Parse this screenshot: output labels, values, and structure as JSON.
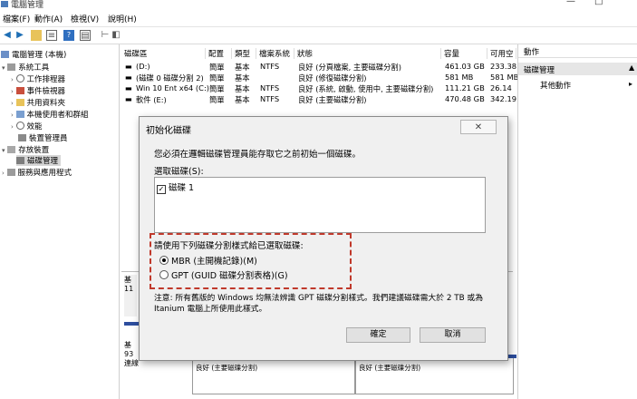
{
  "window": {
    "title": "電腦管理",
    "minimize_glyph": "—",
    "maximize_glyph": "□"
  },
  "menu": [
    "檔案(F)",
    "動作(A)",
    "檢視(V)",
    "說明(H)"
  ],
  "toolbar_icons": [
    "back-icon",
    "forward-icon",
    "folder-icon",
    "list-icon",
    "help-icon",
    "properties-icon",
    "pin-icon",
    "refresh-icon"
  ],
  "tree": [
    {
      "label": "電腦管理 (本機)",
      "icon": "computer-icon",
      "level": 0
    },
    {
      "label": "系統工具",
      "icon": "tools-icon",
      "level": 1
    },
    {
      "label": "工作排程器",
      "icon": "clock-icon",
      "level": 2
    },
    {
      "label": "事件檢視器",
      "icon": "log-icon",
      "level": 2
    },
    {
      "label": "共用資料夾",
      "icon": "folder-icon",
      "level": 2
    },
    {
      "label": "本機使用者和群組",
      "icon": "users-icon",
      "level": 2
    },
    {
      "label": "效能",
      "icon": "performance-icon",
      "level": 2
    },
    {
      "label": "裝置管理員",
      "icon": "device-icon",
      "level": 2
    },
    {
      "label": "存放裝置",
      "icon": "storage-icon",
      "level": 1
    },
    {
      "label": "磁碟管理",
      "icon": "disk-icon",
      "level": 2
    },
    {
      "label": "服務與應用程式",
      "icon": "services-icon",
      "level": 1
    }
  ],
  "volumes": {
    "headers": [
      "磁碟區",
      "配置",
      "類型",
      "檔案系統",
      "狀態",
      "容量",
      "可用空"
    ],
    "rows": [
      [
        "(D:)",
        "簡單",
        "基本",
        "NTFS",
        "良好 (分頁檔案, 主要磁碟分割)",
        "461.03 GB",
        "233.38"
      ],
      [
        "(磁碟 0 磁碟分割 2)",
        "簡單",
        "基本",
        "",
        "良好 (修復磁碟分割)",
        "581 MB",
        "581 MB"
      ],
      [
        "Win 10 Ent x64 (C:)",
        "簡單",
        "基本",
        "NTFS",
        "良好 (系統, 啟動, 使用中, 主要磁碟分割)",
        "111.21 GB",
        "26.14"
      ],
      [
        "軟件 (E:)",
        "簡單",
        "基本",
        "NTFS",
        "良好 (主要磁碟分割)",
        "470.48 GB",
        "342.19"
      ]
    ],
    "disk_labels": [
      "基",
      "11",
      "基",
      "93",
      "連線"
    ],
    "partition_status": [
      "良好 (主要磁碟分割)",
      "良好 (主要磁碟分割)",
      "良好 (分頁檔案, 主要磁碟分割)"
    ]
  },
  "actions": {
    "header": "動作",
    "section": "磁碟管理",
    "more": "其他動作"
  },
  "dialog": {
    "title": "初始化磁碟",
    "message": "您必須在邏輯磁碟管理員能存取它之前初始一個磁碟。",
    "select_label": "選取磁碟(S):",
    "disk_item": "磁碟 1",
    "style_label": "請使用下列磁碟分割樣式給已選取磁碟:",
    "option_mbr": "MBR (主開機記錄)(M)",
    "option_gpt": "GPT (GUID 磁碟分割表格)(G)",
    "selected_option": "MBR",
    "note": "注意: 所有舊版的 Windows 均無法辨識 GPT 磁碟分割樣式。我們建議磁碟需大於 2 TB 或為 Itanium 電腦上所使用此樣式。",
    "ok": "確定",
    "cancel": "取消",
    "close_glyph": "✕",
    "highlight_color": "#c0392b"
  }
}
